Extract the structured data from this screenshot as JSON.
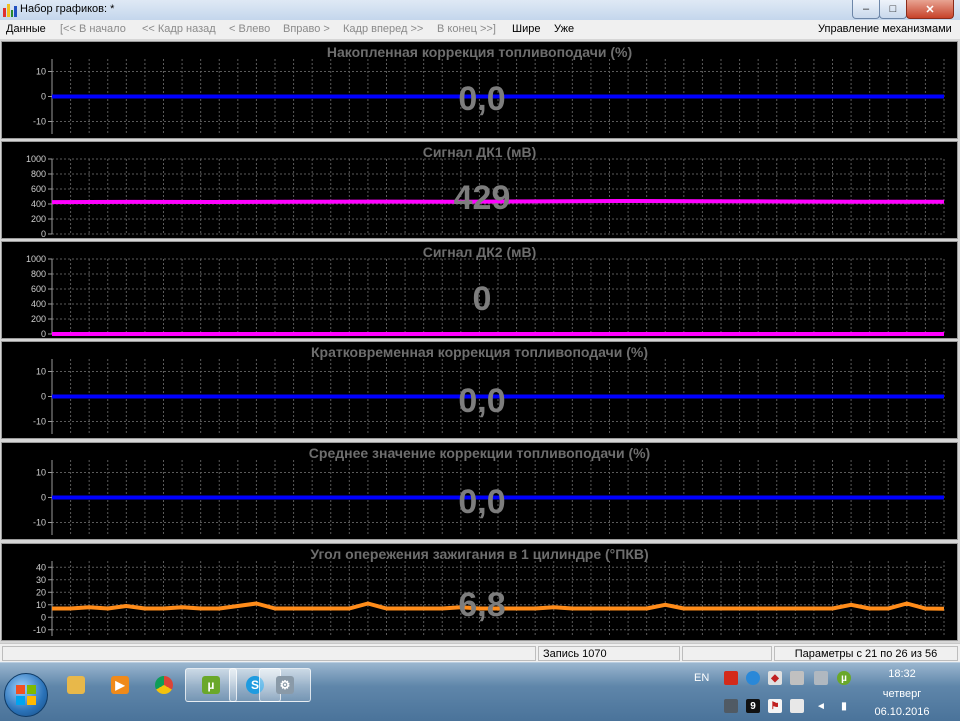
{
  "window": {
    "title": "Набор графиков: *"
  },
  "window_controls": {
    "minimize": "–",
    "maximize": "□",
    "close": "✕"
  },
  "menubar": {
    "data": "Данные",
    "to_start": "[<< В начало",
    "frame_back": "<< Кадр назад",
    "left": "< Влево",
    "right": "Вправо >",
    "frame_forward": "Кадр вперед >>",
    "to_end": "В конец >>]",
    "wider": "Шире",
    "narrower": "Уже",
    "mechanisms": "Управление механизмами"
  },
  "charts": [
    {
      "title": "Накопленная коррекция топливоподачи  (%)",
      "value": "0,0",
      "color": "#0000ff",
      "ticks": [
        "10",
        "0",
        "-10"
      ]
    },
    {
      "title": "Сигнал ДК1  (мВ)",
      "value": "429",
      "color": "#ff00ff",
      "ticks": [
        "1000",
        "800",
        "600",
        "400",
        "200",
        "0"
      ]
    },
    {
      "title": "Сигнал ДК2  (мВ)",
      "value": "0",
      "color": "#ff00ff",
      "ticks": [
        "1000",
        "800",
        "600",
        "400",
        "200",
        "0"
      ]
    },
    {
      "title": "Кратковременная коррекция топливоподачи  (%)",
      "value": "0,0",
      "color": "#0000ff",
      "ticks": [
        "10",
        "0",
        "-10"
      ]
    },
    {
      "title": "Среднее значение коррекции топливоподачи  (%)",
      "value": "0,0",
      "color": "#0000ff",
      "ticks": [
        "10",
        "0",
        "-10"
      ]
    },
    {
      "title": "Угол опережения зажигания в 1 цилиндре  (°ПКВ)",
      "value": "6,8",
      "color": "#ff8c1a",
      "ticks": [
        "40",
        "30",
        "20",
        "10",
        "0",
        "-10"
      ]
    }
  ],
  "chart_data": [
    {
      "type": "line",
      "title": "Накопленная коррекция топливоподачи  (%)",
      "ylim": [
        -15,
        15
      ],
      "y_ticks": [
        10,
        0,
        -10
      ],
      "grid": true,
      "legend": "none",
      "series": [
        {
          "values": [
            0,
            0,
            0,
            0,
            0,
            0,
            0,
            0,
            0,
            0,
            0,
            0
          ]
        }
      ]
    },
    {
      "type": "line",
      "title": "Сигнал ДК1  (мВ)",
      "ylim": [
        0,
        1000
      ],
      "y_ticks": [
        1000,
        800,
        600,
        400,
        200,
        0
      ],
      "grid": true,
      "legend": "none",
      "series": [
        {
          "values": [
            425,
            428,
            426,
            430,
            432,
            430,
            435,
            440,
            437,
            433,
            429,
            429
          ]
        }
      ]
    },
    {
      "type": "line",
      "title": "Сигнал ДК2  (мВ)",
      "ylim": [
        0,
        1000
      ],
      "y_ticks": [
        1000,
        800,
        600,
        400,
        200,
        0
      ],
      "grid": true,
      "legend": "none",
      "series": [
        {
          "values": [
            0,
            0,
            0,
            0,
            0,
            0,
            0,
            0,
            0,
            0,
            0,
            0
          ]
        }
      ]
    },
    {
      "type": "line",
      "title": "Кратковременная коррекция топливоподачи  (%)",
      "ylim": [
        -15,
        15
      ],
      "y_ticks": [
        10,
        0,
        -10
      ],
      "grid": true,
      "legend": "none",
      "series": [
        {
          "values": [
            0,
            0,
            0,
            0,
            0,
            0,
            0,
            0,
            0,
            0,
            0,
            0
          ]
        }
      ]
    },
    {
      "type": "line",
      "title": "Среднее значение коррекции топливоподачи  (%)",
      "ylim": [
        -15,
        15
      ],
      "y_ticks": [
        10,
        0,
        -10
      ],
      "grid": true,
      "legend": "none",
      "series": [
        {
          "values": [
            0,
            0,
            0,
            0,
            0,
            0,
            0,
            0,
            0,
            0,
            0,
            0
          ]
        }
      ]
    },
    {
      "type": "line",
      "title": "Угол опережения зажигания в 1 цилиндре  (°ПКВ)",
      "ylim": [
        -15,
        45
      ],
      "y_ticks": [
        40,
        30,
        20,
        10,
        0,
        -10
      ],
      "grid": true,
      "legend": "none",
      "series": [
        {
          "values": [
            7,
            7,
            8,
            7,
            9,
            7,
            7,
            8,
            7,
            7,
            9,
            11,
            7,
            7,
            7,
            7,
            7,
            11,
            7,
            7,
            7,
            7,
            8,
            7,
            7,
            7,
            7,
            8,
            7,
            7,
            7,
            7,
            7,
            10,
            7,
            7,
            7,
            7,
            7,
            7,
            7,
            7,
            7,
            10,
            7,
            7,
            11,
            7,
            6.8
          ]
        }
      ]
    }
  ],
  "statusbar": {
    "record": "Запись 1070",
    "params": "Параметры с 21 по 26 из 56"
  },
  "taskbar": {
    "lang": "EN",
    "time": "18:32",
    "day": "четверг",
    "date": "06.10.2016",
    "badge_count": "9"
  }
}
